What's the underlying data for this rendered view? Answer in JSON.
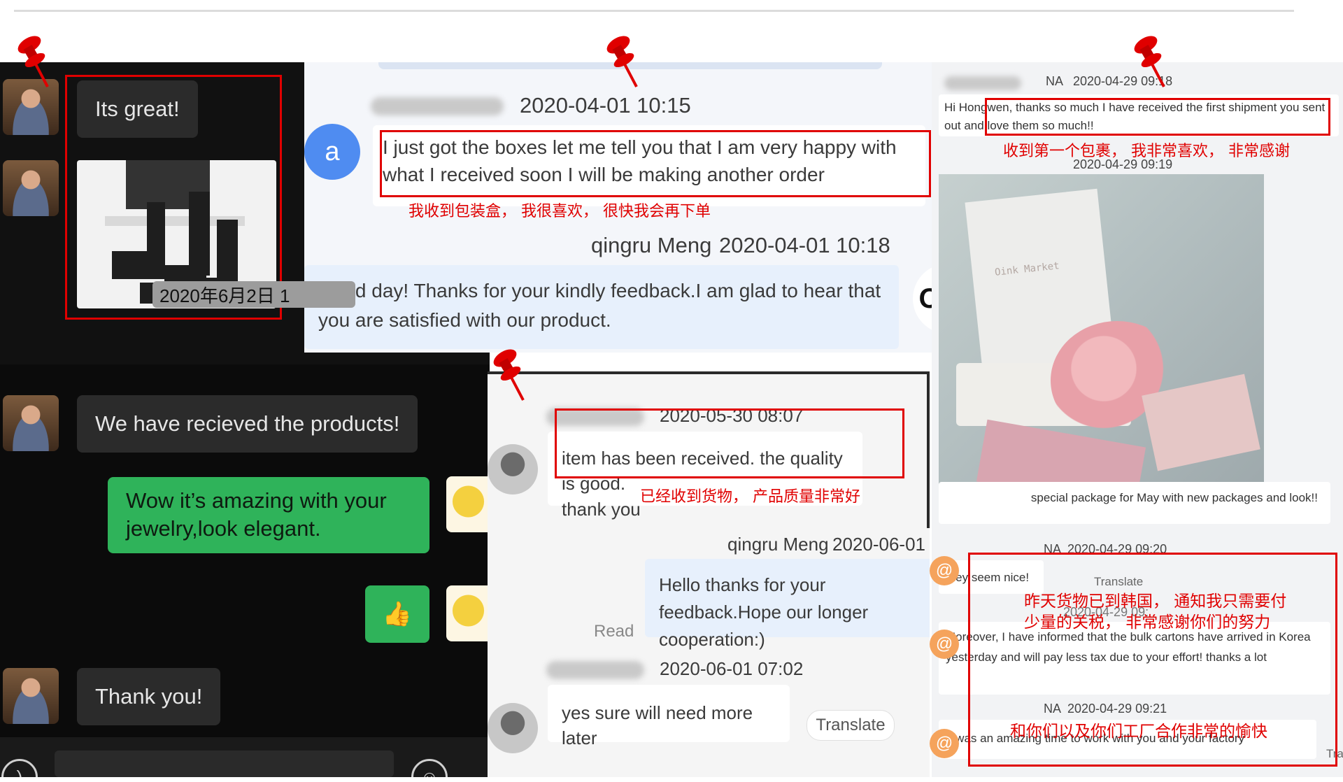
{
  "panel1": {
    "messages": {
      "its_great": "Its great!",
      "received": "We have recieved the products!",
      "amazing": "Wow it’s amazing with your jewelry,look elegant.",
      "thumbs": "👍",
      "thanks": "Thank you!"
    },
    "date_chip": "2020年6月2日 1"
  },
  "panel2": {
    "msg1": {
      "time": "2020-04-01 10:15",
      "avatar_letter": "a",
      "text": "I just got the boxes let me tell you that I am very happy with what I received soon I will be making another order"
    },
    "msg2": {
      "name": "qingru Meng",
      "time": "2020-04-01 10:18",
      "text": "Good day! Thanks for your kindly feedback.I am glad to hear that you are satisfied with our product."
    },
    "logo": "OPQ"
  },
  "panel3": {
    "msg1": {
      "time": "2020-05-30 08:07",
      "text_line1": "item has been received. the quality is good.",
      "text_line2": "thank you"
    },
    "reply": {
      "name": "qingru Meng",
      "time": "2020-06-01",
      "text": "Hello thanks for your feedback.Hope our longer cooperation:)",
      "read": "Read"
    },
    "msg3": {
      "time": "2020-06-01 07:02",
      "text": "yes sure will need more later",
      "translate": "Translate"
    }
  },
  "panel4": {
    "msg1": {
      "name": "NA",
      "time": "2020-04-29 09:18",
      "text": "Hi Hongwen, thanks so much I have received the first shipment you sent out and love them so much!!"
    },
    "photo_time": "2020-04-29 09:19",
    "photo_brand": "Oink Market",
    "msg2_text": "special package for May with new packages and look!!",
    "msg3": {
      "name": "NA",
      "time": "2020-04-29 09:20",
      "text": "they seem nice!",
      "translate": "Translate"
    },
    "msg4": {
      "time": "2020-04-29 09:",
      "text": "Moreover, I have informed that the bulk cartons have arrived in Korea yesterday and will pay less tax due to your effort! thanks a lot"
    },
    "msg5": {
      "name": "NA",
      "time": "2020-04-29 09:21",
      "text": "It was an amazing time to work with you and your factory",
      "translate_cut": "Tra"
    },
    "at_symbol": "@"
  },
  "annotations": {
    "cn1": "我收到包装盒，  我很喜欢，  很快我会再下单",
    "cn2": "已经收到货物，  产品质量非常好",
    "cn3": "收到第一个包裹，  我非常喜欢，  非常感谢",
    "cn4_line1": "昨天货物已到韩国，  通知我只需要付",
    "cn4_line2": "少量的关税，  非常感谢你们的努力",
    "cn5": "和你们以及你们工厂合作非常的愉快"
  },
  "colors": {
    "annotation_red": "#e00000",
    "wechat_green": "#2fb35a",
    "avatar_blue": "#4f8cf1",
    "at_orange": "#f5a35c"
  }
}
